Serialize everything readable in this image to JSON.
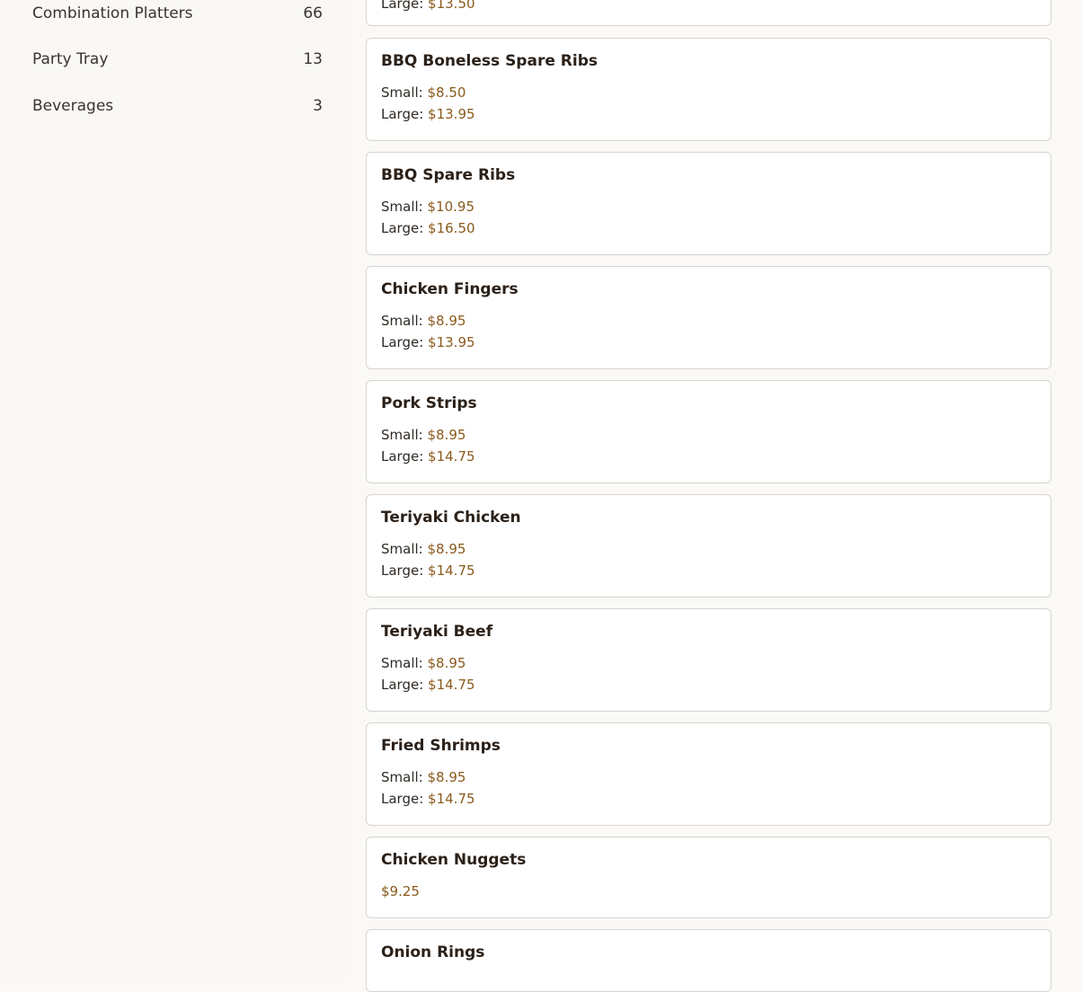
{
  "sidebar": {
    "categories": [
      {
        "name": "Combination Platters",
        "count": "66"
      },
      {
        "name": "Party Tray",
        "count": "13"
      },
      {
        "name": "Beverages",
        "count": "3"
      }
    ]
  },
  "menu": {
    "partial_top": {
      "large_label": "Large:",
      "large_price": "$13.50"
    },
    "items": [
      {
        "name": "BBQ Boneless Spare Ribs",
        "small_label": "Small:",
        "small_price": "$8.50",
        "large_label": "Large:",
        "large_price": "$13.95"
      },
      {
        "name": "BBQ Spare Ribs",
        "small_label": "Small:",
        "small_price": "$10.95",
        "large_label": "Large:",
        "large_price": "$16.50"
      },
      {
        "name": "Chicken Fingers",
        "small_label": "Small:",
        "small_price": "$8.95",
        "large_label": "Large:",
        "large_price": "$13.95"
      },
      {
        "name": "Pork Strips",
        "small_label": "Small:",
        "small_price": "$8.95",
        "large_label": "Large:",
        "large_price": "$14.75"
      },
      {
        "name": "Teriyaki Chicken",
        "small_label": "Small:",
        "small_price": "$8.95",
        "large_label": "Large:",
        "large_price": "$14.75"
      },
      {
        "name": "Teriyaki Beef",
        "small_label": "Small:",
        "small_price": "$8.95",
        "large_label": "Large:",
        "large_price": "$14.75"
      },
      {
        "name": "Fried Shrimps",
        "small_label": "Small:",
        "small_price": "$8.95",
        "large_label": "Large:",
        "large_price": "$14.75"
      },
      {
        "name": "Chicken Nuggets",
        "price": "$9.25"
      },
      {
        "name": "Onion Rings"
      }
    ]
  },
  "colors": {
    "price": "#8a5a1c",
    "card_border": "#d8d4cf",
    "background": "#faf9f6"
  }
}
